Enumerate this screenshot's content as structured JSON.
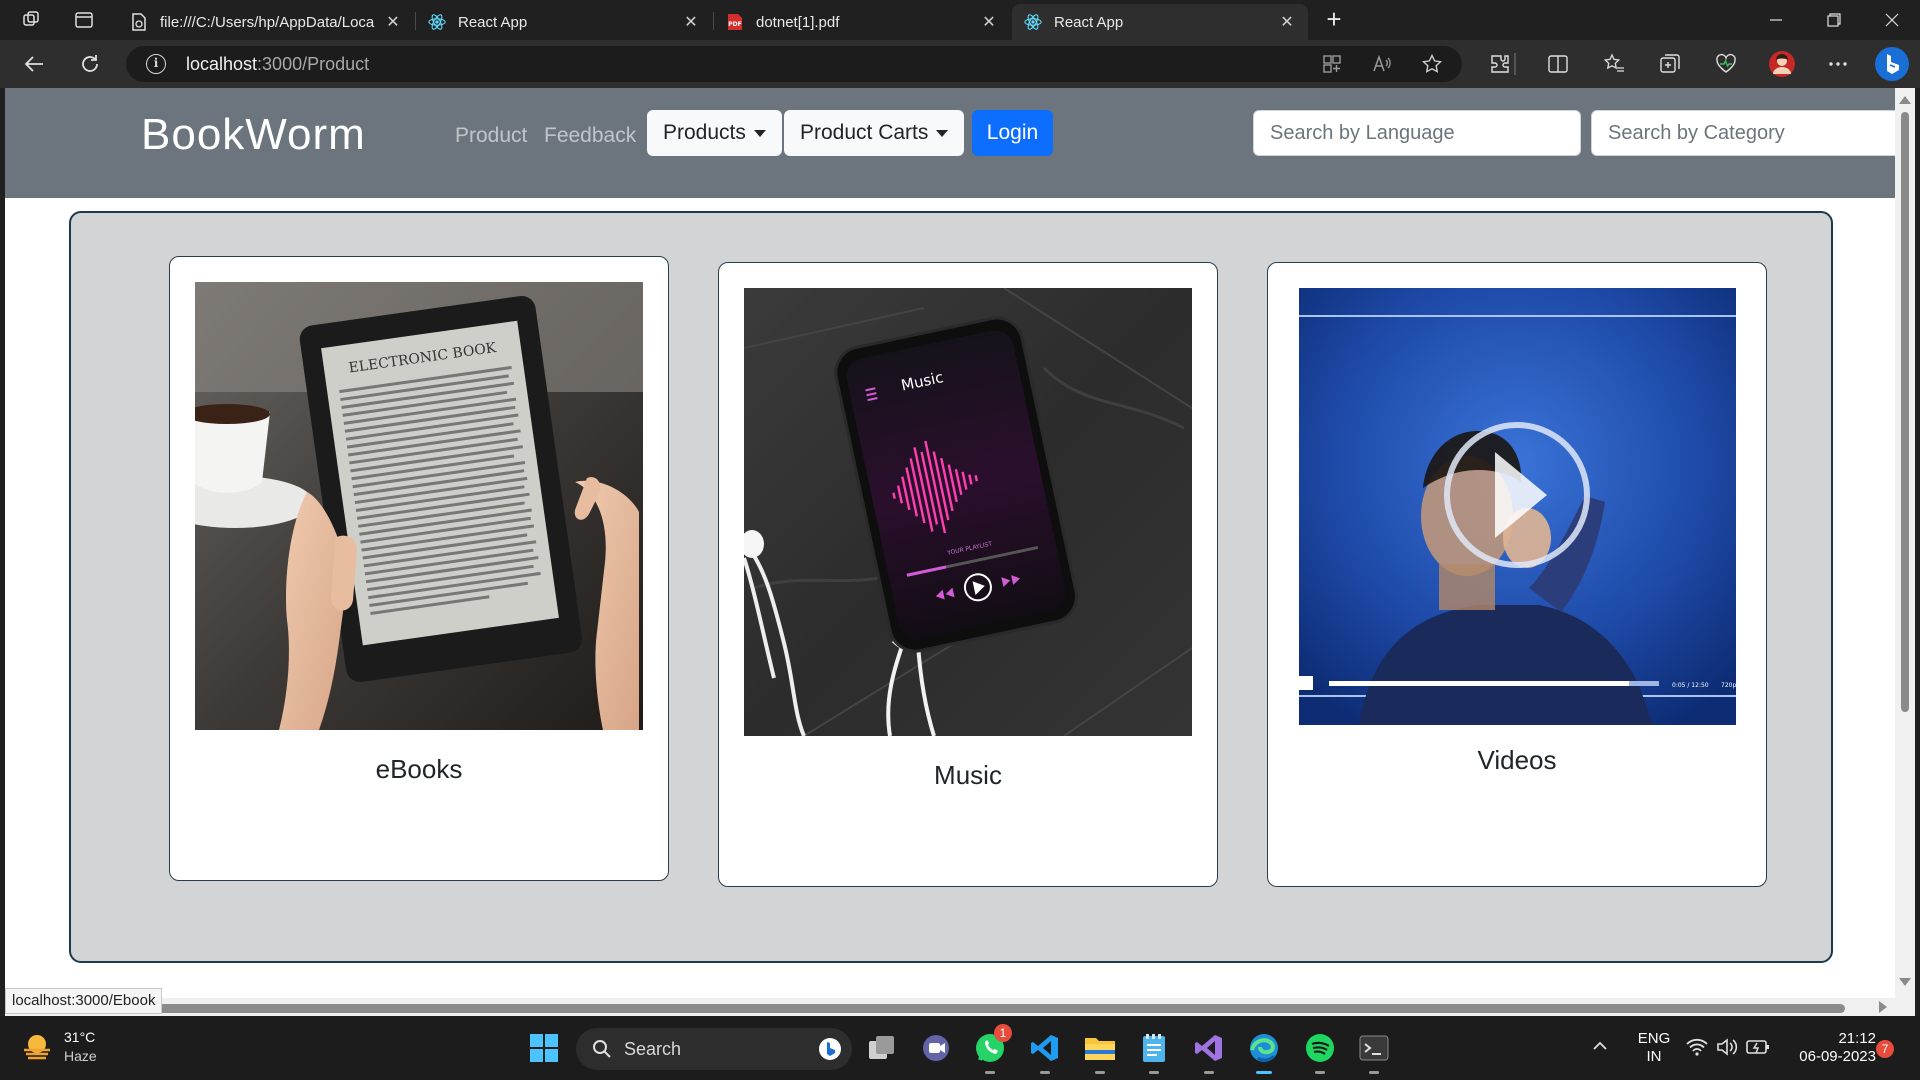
{
  "browser": {
    "tabs": [
      {
        "title": "file:///C:/Users/hp/AppData/Loca",
        "icon": "file-icon"
      },
      {
        "title": "React App",
        "icon": "react-icon"
      },
      {
        "title": "dotnet[1].pdf",
        "icon": "pdf-icon"
      },
      {
        "title": "React App",
        "icon": "react-icon",
        "active": true
      }
    ],
    "url_host": "localhost",
    "url_path": ":3000/Product",
    "status_link": "localhost:3000/Ebook"
  },
  "navbar": {
    "brand": "BookWorm",
    "links": [
      "Product",
      "Feedback"
    ],
    "dropdowns": [
      "Products",
      "Product Carts"
    ],
    "login_label": "Login",
    "search_language_placeholder": "Search by Language",
    "search_category_placeholder": "Search by Category",
    "color": "#6c757d",
    "login_color": "#0d6efd"
  },
  "cards": [
    {
      "title": "eBooks",
      "image": "ebook-reader-image"
    },
    {
      "title": "Music",
      "image": "music-phone-image"
    },
    {
      "title": "Videos",
      "image": "video-play-image"
    }
  ],
  "ebook_screen": {
    "heading": "ELECTRONIC BOOK"
  },
  "music_screen": {
    "heading": "Music",
    "playlist": "YOUR PLAYLIST"
  },
  "video_screen": {
    "time": "0:05 / 12:50",
    "quality": "720p"
  },
  "taskbar": {
    "temperature": "31°C",
    "condition": "Haze",
    "search_label": "Search",
    "whatsapp_badge": "1",
    "lang_top": "ENG",
    "lang_bottom": "IN",
    "time": "21:12",
    "date": "06-09-2023",
    "notification_count": "7"
  }
}
